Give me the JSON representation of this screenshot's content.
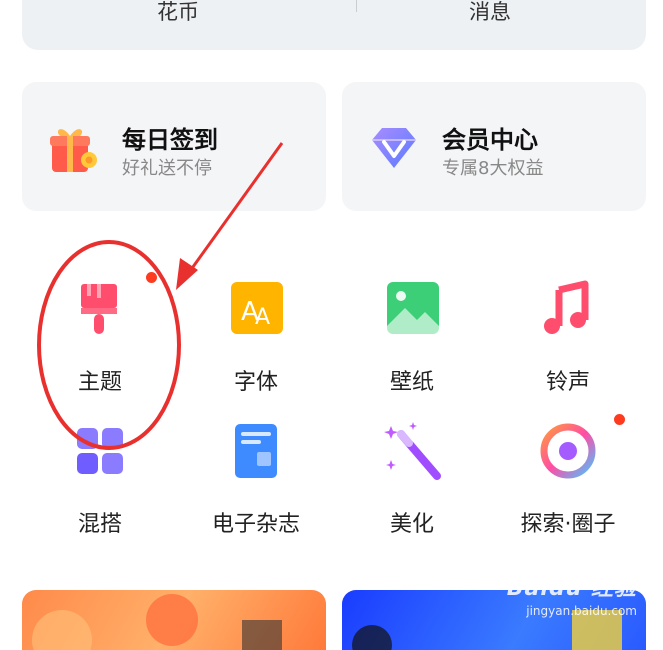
{
  "top_tabs": [
    {
      "label": "花币"
    },
    {
      "label": "消息"
    }
  ],
  "cards": [
    {
      "title": "每日签到",
      "subtitle": "好礼送不停",
      "icon": "gift-icon"
    },
    {
      "title": "会员中心",
      "subtitle": "专属8大权益",
      "icon": "vip-diamond-icon"
    }
  ],
  "grid": [
    {
      "label": "主题",
      "icon": "theme-brush-icon",
      "badge": true
    },
    {
      "label": "字体",
      "icon": "font-icon",
      "badge": false
    },
    {
      "label": "壁纸",
      "icon": "wallpaper-icon",
      "badge": false
    },
    {
      "label": "铃声",
      "icon": "ringtone-icon",
      "badge": false
    },
    {
      "label": "混搭",
      "icon": "mix-match-icon",
      "badge": false
    },
    {
      "label": "电子杂志",
      "icon": "magazine-icon",
      "badge": false
    },
    {
      "label": "美化",
      "icon": "beautify-wand-icon",
      "badge": false
    },
    {
      "label": "探索·圈子",
      "icon": "explore-circle-icon",
      "badge": true
    }
  ],
  "watermark": {
    "line1": "Baidu 经验",
    "line2": "jingyan.baidu.com"
  },
  "colors": {
    "accent_red": "#ff3b1f",
    "annotation_red": "#e8312f"
  }
}
